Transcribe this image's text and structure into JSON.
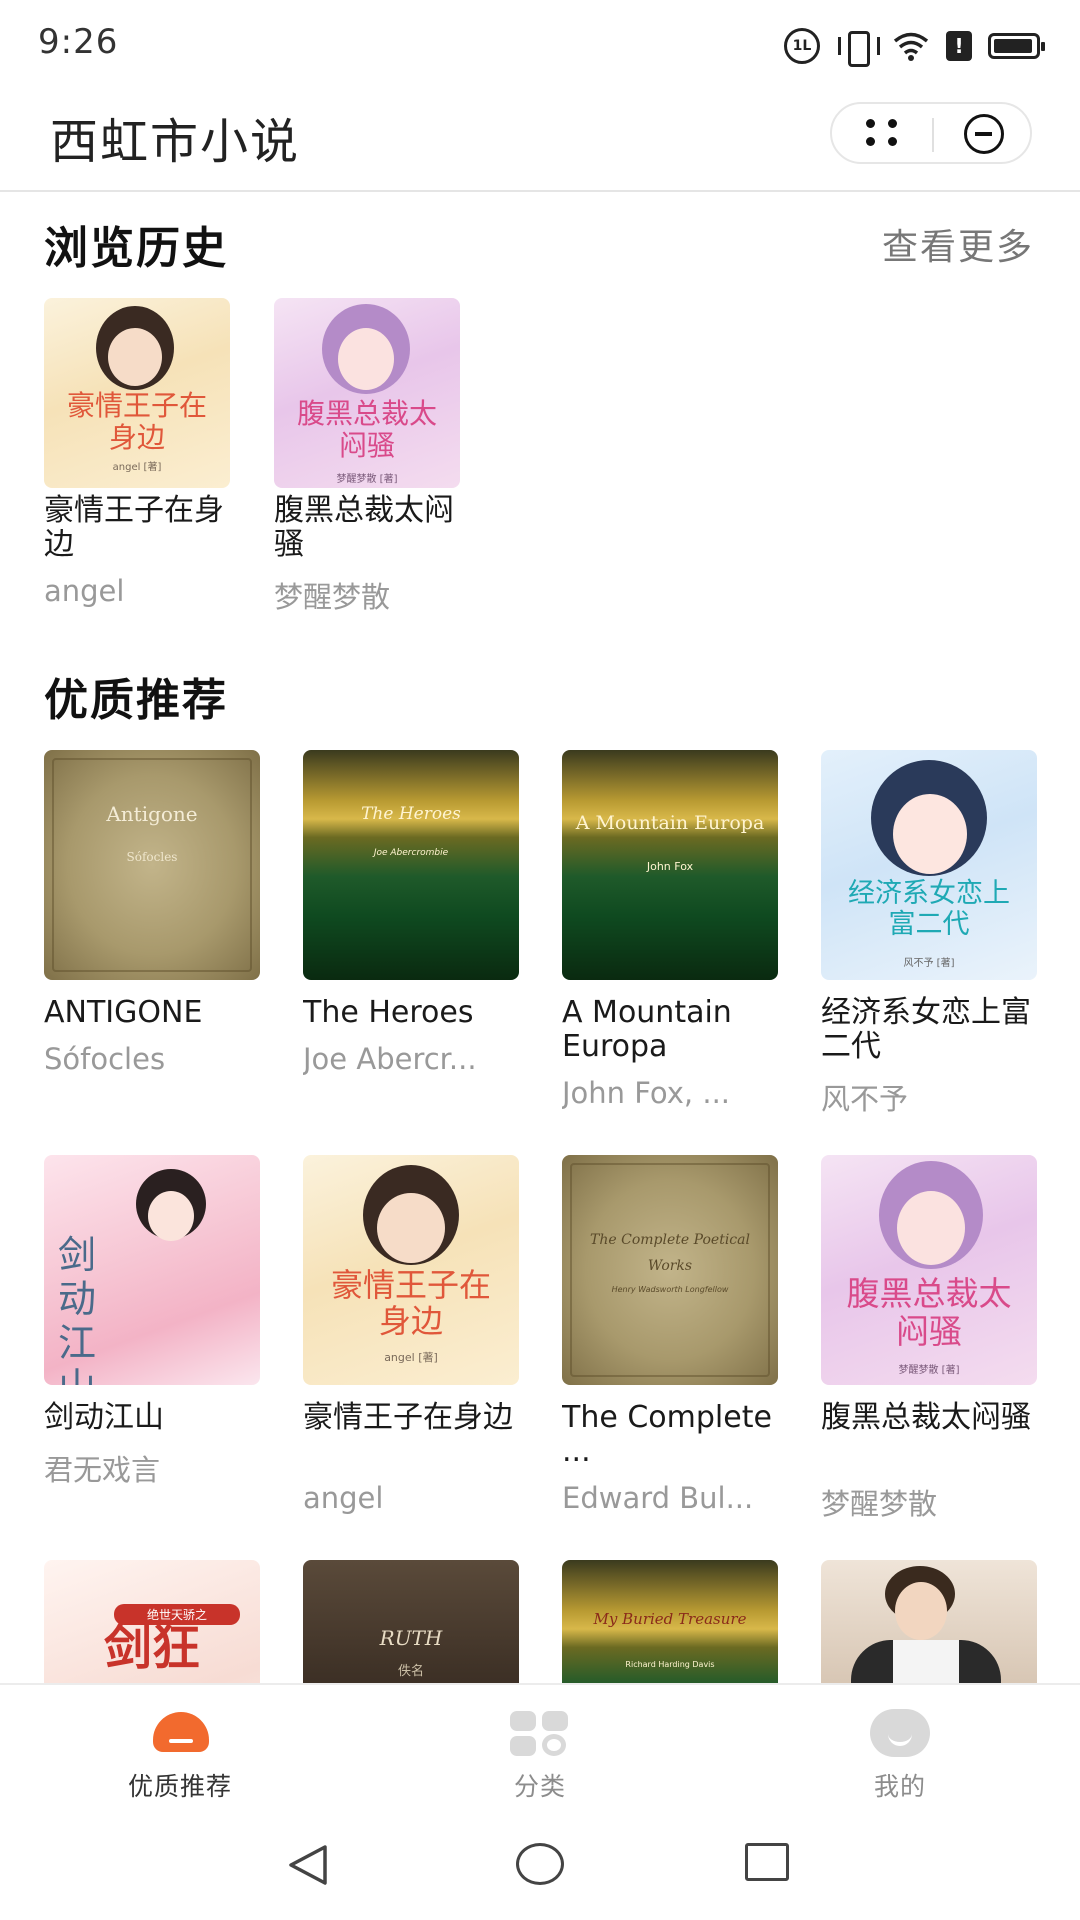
{
  "status_bar": {
    "time": "9:26",
    "sim_badge": "1L",
    "icons": [
      "sim-icon",
      "vibrate-icon",
      "wifi-icon",
      "alert-icon",
      "battery-icon"
    ]
  },
  "nav": {
    "title": "西虹市小说",
    "capsule_icons": [
      "more-dots-icon",
      "close-circle-icon"
    ]
  },
  "history": {
    "title": "浏览历史",
    "more_label": "查看更多",
    "books": [
      {
        "title": "豪情王子在身边",
        "author": "angel",
        "cover_text": "豪情王子在身边",
        "cover_sub": "angel [著]"
      },
      {
        "title": "腹黑总裁太闷骚",
        "author": "梦醒梦散",
        "cover_text": "腹黑总裁太闷骚",
        "cover_sub": "梦醒梦散 [著]"
      }
    ]
  },
  "recommend": {
    "title": "优质推荐",
    "books": [
      {
        "title": "ANTIGONE",
        "author": "Sófocles",
        "cover_text": "Antigone",
        "cover_sub": "Sófocles"
      },
      {
        "title": "The Heroes",
        "author": "Joe Abercr...",
        "cover_text": "The Heroes",
        "cover_sub": "Joe Abercrombie"
      },
      {
        "title": "A Mountain Europa",
        "author": "John Fox, ...",
        "cover_text": "A Mountain Europa",
        "cover_sub": "John Fox"
      },
      {
        "title": "经济系女恋上富二代",
        "author": "风不予",
        "cover_text": "经济系女恋上富二代",
        "cover_sub": "风不予 [著]"
      },
      {
        "title": "剑动江山",
        "author": "君无戏言",
        "cover_text": "剑动江山",
        "cover_sub": ""
      },
      {
        "title": "豪情王子在身边",
        "author": "angel",
        "cover_text": "豪情王子在身边",
        "cover_sub": "angel [著]"
      },
      {
        "title": "The Complete ...",
        "author": "Edward Bul...",
        "cover_text": "The Complete Poetical Works",
        "cover_sub": "Henry Wadsworth Longfellow"
      },
      {
        "title": "腹黑总裁太闷骚",
        "author": "梦醒梦散",
        "cover_text": "腹黑总裁太闷骚",
        "cover_sub": "梦醒梦散 [著]"
      },
      {
        "title": "",
        "author": "",
        "cover_text": "剑狂",
        "cover_sub": "绝世天骄之"
      },
      {
        "title": "",
        "author": "",
        "cover_text": "RUTH",
        "cover_sub": "佚名"
      },
      {
        "title": "",
        "author": "",
        "cover_text": "My Buried Treasure",
        "cover_sub": "Richard Harding Davis"
      },
      {
        "title": "",
        "author": "",
        "cover_text": "",
        "cover_sub": ""
      }
    ]
  },
  "tabbar": {
    "tabs": [
      {
        "label": "优质推荐",
        "icon": "home-tab-icon",
        "active": true
      },
      {
        "label": "分类",
        "icon": "category-tab-icon",
        "active": false
      },
      {
        "label": "我的",
        "icon": "profile-tab-icon",
        "active": false
      }
    ]
  },
  "colors": {
    "accent": "#f26a2e",
    "muted": "#999999",
    "inactive_icon": "#d9d9d9"
  }
}
